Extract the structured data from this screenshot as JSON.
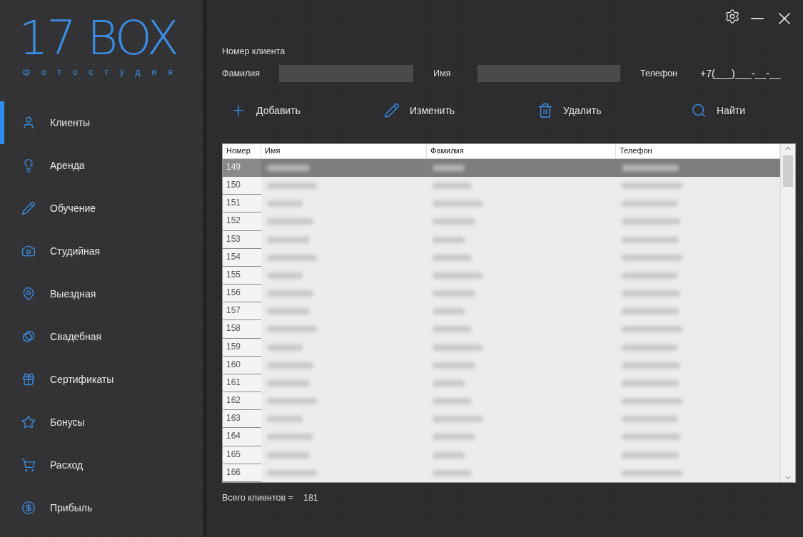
{
  "logo": {
    "title": "17 BOX",
    "subtitle": "фотостудия"
  },
  "sidebar": {
    "items": [
      {
        "label": "Клиенты",
        "selected": true
      },
      {
        "label": "Аренда",
        "selected": false
      },
      {
        "label": "Обучение",
        "selected": false
      },
      {
        "label": "Студийная",
        "selected": false
      },
      {
        "label": "Выездная",
        "selected": false
      },
      {
        "label": "Свадебная",
        "selected": false
      },
      {
        "label": "Сертификаты",
        "selected": false
      },
      {
        "label": "Бонусы",
        "selected": false
      },
      {
        "label": "Расход",
        "selected": false
      },
      {
        "label": "Прибыль",
        "selected": false
      }
    ]
  },
  "form": {
    "title": "Номер клиента",
    "fields": [
      {
        "label": "Фамилия",
        "kind": "text"
      },
      {
        "label": "Имя",
        "kind": "text"
      },
      {
        "label": "Телефон",
        "kind": "masked",
        "value": "+7(___)___-__-__"
      }
    ]
  },
  "toolbar": [
    {
      "label": "Добавить"
    },
    {
      "label": "Изменить"
    },
    {
      "label": "Удалить"
    },
    {
      "label": "Найти"
    }
  ],
  "table": {
    "columns": [
      "Номер",
      "Имя",
      "Фамилия",
      "Телефон"
    ],
    "rows": [
      {
        "number": "149",
        "selected": true
      },
      {
        "number": "150",
        "selected": false
      },
      {
        "number": "151",
        "selected": false
      },
      {
        "number": "152",
        "selected": false
      },
      {
        "number": "153",
        "selected": false
      },
      {
        "number": "154",
        "selected": false
      },
      {
        "number": "155",
        "selected": false
      },
      {
        "number": "156",
        "selected": false
      },
      {
        "number": "157",
        "selected": false
      },
      {
        "number": "158",
        "selected": false
      },
      {
        "number": "159",
        "selected": false
      },
      {
        "number": "160",
        "selected": false
      },
      {
        "number": "161",
        "selected": false
      },
      {
        "number": "162",
        "selected": false
      },
      {
        "number": "163",
        "selected": false
      },
      {
        "number": "164",
        "selected": false
      },
      {
        "number": "165",
        "selected": false
      },
      {
        "number": "166",
        "selected": false
      }
    ]
  },
  "status": {
    "label": "Всего клиентов =",
    "value": "181"
  }
}
